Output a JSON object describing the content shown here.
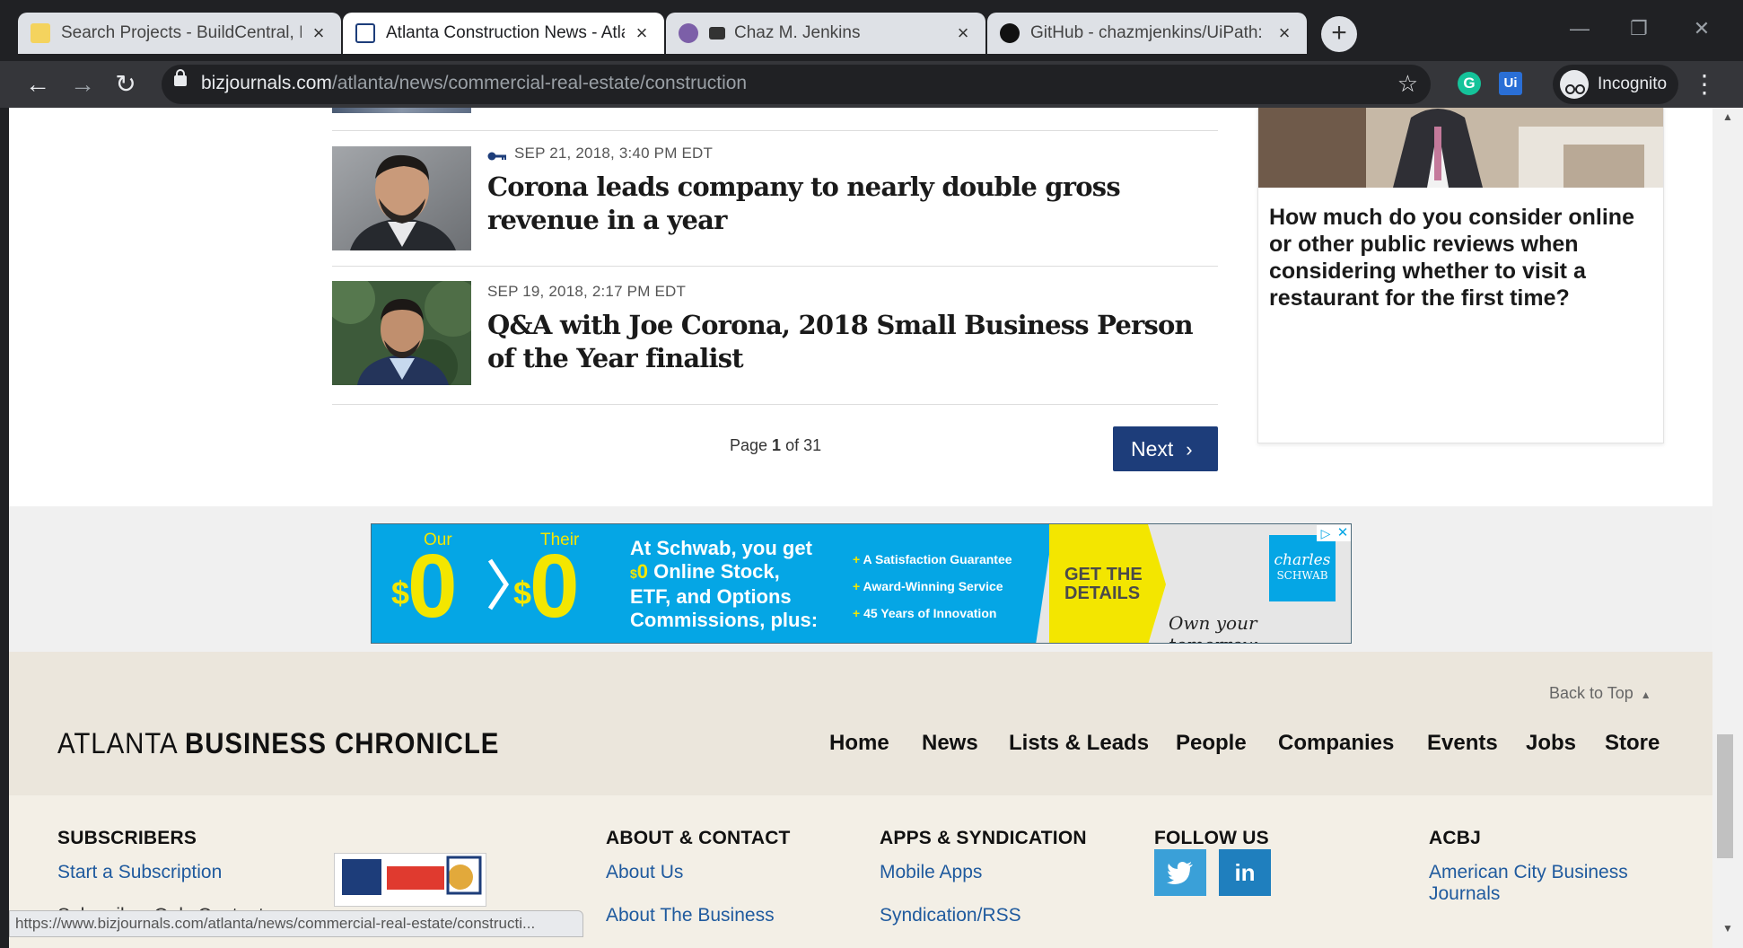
{
  "tabs": [
    {
      "title": "Search Projects - BuildCentral, Inc",
      "favicon": "sticky-note-icon"
    },
    {
      "title": "Atlanta Construction News - Atlanta",
      "favicon": "bizjournals-icon"
    },
    {
      "title": "Chaz M. Jenkins",
      "favicon": "avatar-icon"
    },
    {
      "title": "GitHub - chazmjenkins/UiPath: Re",
      "favicon": "github-icon"
    }
  ],
  "toolbar": {
    "url_host": "bizjournals.com",
    "url_path": "/atlanta/news/commercial-real-estate/construction",
    "profile_label": "Incognito",
    "ext_grammarly": "G",
    "ext_uipath": "Ui"
  },
  "articles": [
    {
      "date": "SEP 21, 2018, 3:40 PM EDT",
      "title": "Corona leads company to nearly double gross revenue in a year",
      "premium": true
    },
    {
      "date": "SEP 19, 2018, 2:17 PM EDT",
      "title": "Q&A with Joe Corona, 2018 Small Business Person of the Year finalist",
      "premium": false
    }
  ],
  "pagination": {
    "prefix": "Page ",
    "current": "1",
    "suffix": " of 31",
    "next_label": "Next"
  },
  "poll": {
    "question": "How much do you consider online or other public reviews when considering whether to visit a restaurant for the first time?"
  },
  "ad": {
    "our_label": "Our",
    "their_label": "Their",
    "dollar": "$",
    "zero": "0",
    "headline_line1": "At Schwab, you get",
    "headline_line2_dollar": "$",
    "headline_line2_zero": "0",
    "headline_line2": " Online Stock,",
    "headline_line3": "ETF, and Options",
    "headline_line4": "Commissions, plus:",
    "benefits": [
      "A Satisfaction Guarantee",
      "Award-Winning Service",
      "45 Years of Innovation"
    ],
    "cta_line1": "GET THE",
    "cta_line2": "DETAILS",
    "brand_line1": "charles",
    "brand_line2": "SCHWAB",
    "tagline": "Own your tomorrow.",
    "colors": {
      "blue": "#05a6e5",
      "yellow": "#f3e600",
      "gray": "#e6e6e6"
    }
  },
  "footer": {
    "back_to_top": "Back to Top",
    "brand_light": "ATLANTA ",
    "brand_bold": "BUSINESS CHRONICLE",
    "nav": [
      "Home",
      "News",
      "Lists & Leads",
      "People",
      "Companies",
      "Events",
      "Jobs",
      "Store"
    ],
    "columns": {
      "subscribers": {
        "heading": "SUBSCRIBERS",
        "links": [
          "Start a Subscription",
          "Subscriber-Only Content"
        ]
      },
      "about": {
        "heading": "ABOUT & CONTACT",
        "links": [
          "About Us",
          "About The Business"
        ]
      },
      "apps": {
        "heading": "APPS & SYNDICATION",
        "links": [
          "Mobile Apps",
          "Syndication/RSS"
        ]
      },
      "follow": {
        "heading": "FOLLOW US"
      },
      "acbj": {
        "heading": "ACBJ",
        "links": [
          "American City Business",
          "Journals"
        ]
      }
    }
  },
  "status_bar": {
    "url": "https://www.bizjournals.com/atlanta/news/commercial-real-estate/constructi..."
  }
}
